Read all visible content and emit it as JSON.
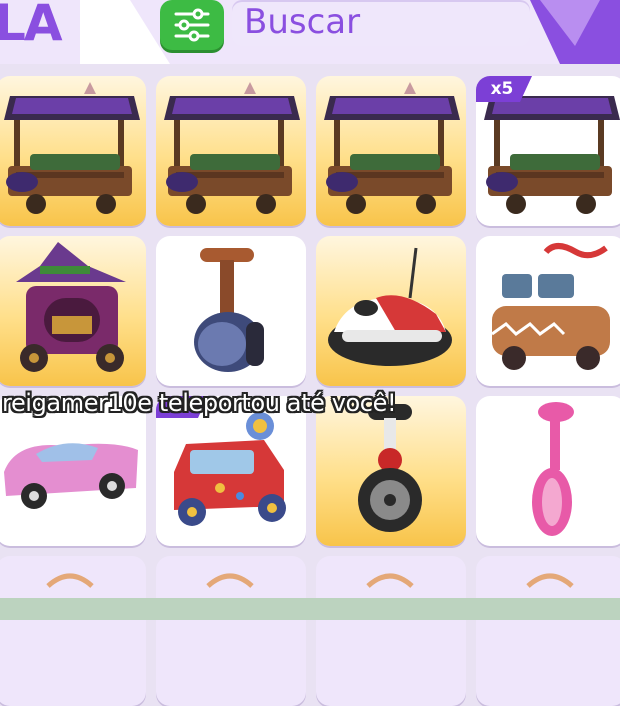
{
  "header": {
    "title_fragment": "LA",
    "filter_icon": "sliders-icon",
    "search_placeholder": "Buscar"
  },
  "inventory": {
    "rows": [
      [
        {
          "item": "cart",
          "count": ""
        },
        {
          "item": "cart",
          "count": ""
        },
        {
          "item": "cart",
          "count": ""
        },
        {
          "item": "cart",
          "count": "x5"
        }
      ],
      [
        {
          "item": "carriage",
          "count": ""
        },
        {
          "item": "segway",
          "count": ""
        },
        {
          "item": "bumper-car",
          "count": ""
        },
        {
          "item": "gingerbread-van",
          "count": ""
        }
      ],
      [
        {
          "item": "pink-car",
          "count": ""
        },
        {
          "item": "toy-car",
          "count": "x3"
        },
        {
          "item": "unicycle",
          "count": ""
        },
        {
          "item": "pink-unicycle",
          "count": ""
        }
      ]
    ]
  },
  "notification": {
    "text": "reigamer10e teleportou até você!"
  },
  "colors": {
    "accent": "#8a4fe0",
    "filter_button": "#3dbb44",
    "gold_tile": "#ffdf8a",
    "badge": "#7c3fd6"
  }
}
